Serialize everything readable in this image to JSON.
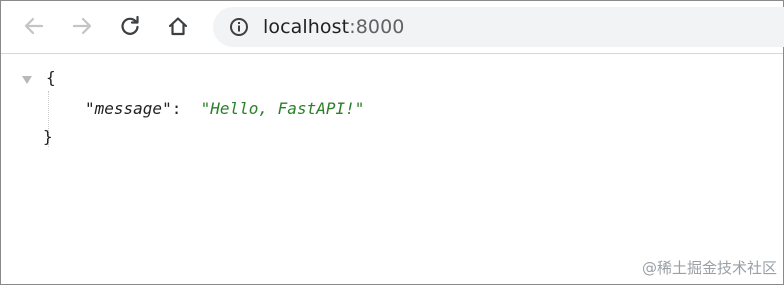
{
  "toolbar": {
    "back_icon": "arrow-left-icon",
    "forward_icon": "arrow-right-icon",
    "reload_icon": "reload-icon",
    "home_icon": "home-icon"
  },
  "omnibox": {
    "info_icon": "info-icon",
    "host": "localhost",
    "port": ":8000"
  },
  "viewer": {
    "open_brace": "{",
    "key": "\"message\"",
    "colon": ":",
    "value": "\"Hello, FastAPI!\"",
    "close_brace": "}"
  },
  "watermark": "@稀土掘金技术社区",
  "colors": {
    "string": "#2a7f2a",
    "omnibox_bg": "#f1f3f4",
    "icon_disabled": "#bdbdbd",
    "icon_active": "#3c4043"
  }
}
